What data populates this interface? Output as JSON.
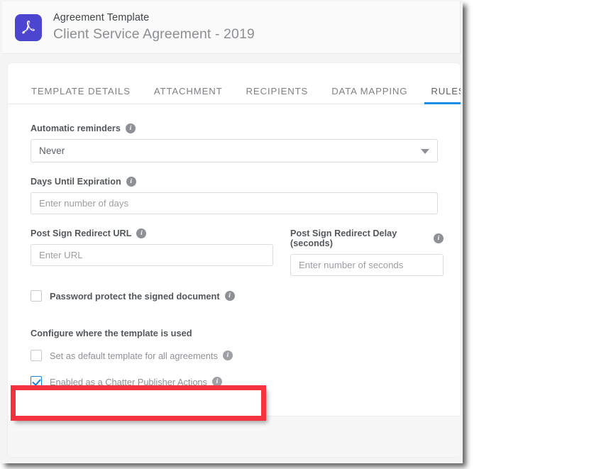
{
  "header": {
    "icon": "pdf-icon",
    "kicker": "Agreement Template",
    "title": "Client Service Agreement - 2019"
  },
  "tabs": [
    {
      "label": "TEMPLATE DETAILS",
      "active": false
    },
    {
      "label": "ATTACHMENT",
      "active": false
    },
    {
      "label": "RECIPIENTS",
      "active": false
    },
    {
      "label": "DATA MAPPING",
      "active": false
    },
    {
      "label": "RULES",
      "active": true
    }
  ],
  "form": {
    "automatic_reminders": {
      "label": "Automatic reminders",
      "info": "i",
      "value": "Never",
      "options": [
        "Never"
      ]
    },
    "days_until_expiration": {
      "label": "Days Until Expiration",
      "info": "i",
      "value": "",
      "placeholder": "Enter number of days"
    },
    "post_sign_redirect_url": {
      "label": "Post Sign Redirect URL",
      "info": "i",
      "value": "",
      "placeholder": "Enter URL"
    },
    "post_sign_redirect_delay": {
      "label": "Post Sign Redirect Delay (seconds)",
      "info": "i",
      "value": "",
      "placeholder": "Enter number of seconds"
    },
    "password_protect": {
      "label": "Password protect the signed document",
      "info": "i",
      "checked": false
    },
    "configure_section": {
      "heading": "Configure where the template is used",
      "set_default": {
        "label": "Set as default template for all agreements",
        "info": "i",
        "checked": false
      },
      "chatter_publisher": {
        "label": "Enabled as a Chatter Publisher Actions",
        "info": "i",
        "checked": true
      }
    }
  },
  "annotation": {
    "color": "#f5333f",
    "target": "Enabled as a Chatter Publisher Actions"
  },
  "colors": {
    "accent_blue": "#1a8fe3",
    "checkbox_blue": "#1a82d8",
    "pdf_icon_purple": "#4b45cf",
    "annotation_red": "#f5333f"
  }
}
